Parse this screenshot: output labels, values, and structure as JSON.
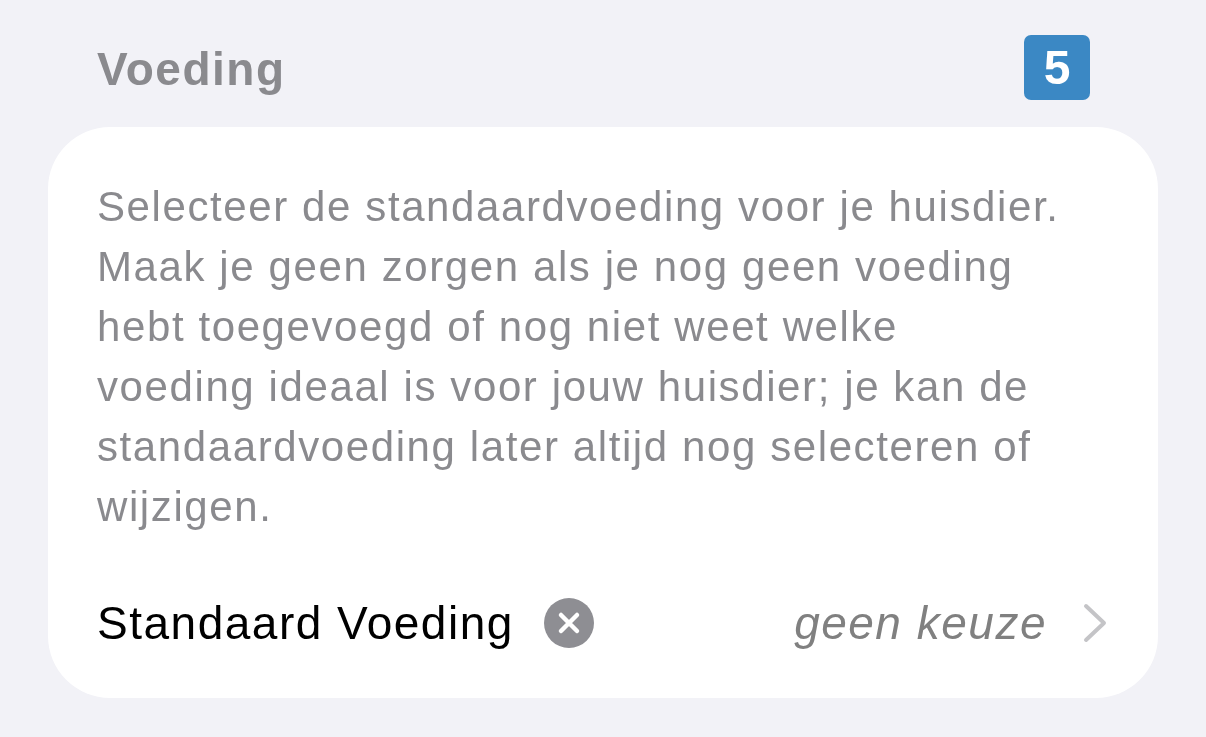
{
  "section": {
    "title": "Voeding",
    "badge": "5"
  },
  "card": {
    "description": "Selecteer de standaardvoeding voor je huisdier. Maak je geen zorgen als je nog geen voeding hebt toegevoegd of nog niet weet welke voeding ideaal is voor jouw huisdier; je kan de standaardvoeding later altijd nog selecteren of wijzigen.",
    "row": {
      "label": "Standaard Voeding",
      "value": "geen keuze"
    }
  }
}
